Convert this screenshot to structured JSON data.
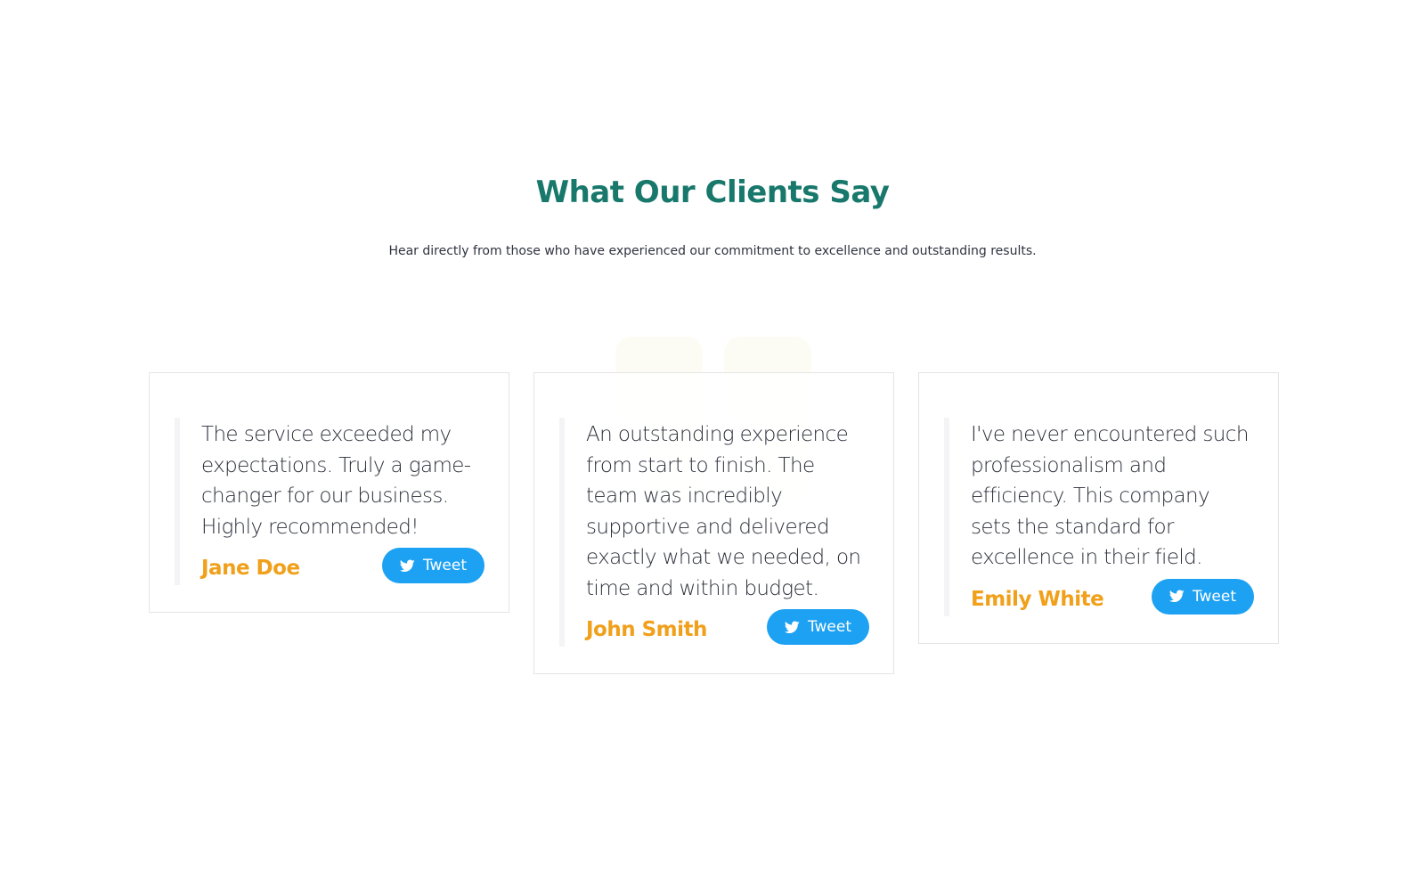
{
  "section": {
    "title": "What Our Clients Say",
    "subtitle": "Hear directly from those who have experienced our commitment to excellence and outstanding results."
  },
  "colors": {
    "title": "#17786b",
    "name": "#f0a01a",
    "tweet": "#1da1f2",
    "text": "#2c2f3b"
  },
  "testimonials": [
    {
      "quote": "The service exceeded my expectations. Truly a game-changer for our business. Highly recommended!",
      "name": "Jane Doe",
      "button_label": "Tweet",
      "button_icon": "twitter-bird-icon"
    },
    {
      "quote": "An outstanding experience from start to finish. The team was incredibly supportive and delivered exactly what we needed, on time and within budget.",
      "name": "John Smith",
      "button_label": "Tweet",
      "button_icon": "twitter-bird-icon"
    },
    {
      "quote": "I've never encountered such professionalism and efficiency. This company sets the standard for excellence in their field.",
      "name": "Emily White",
      "button_label": "Tweet",
      "button_icon": "twitter-bird-icon"
    }
  ]
}
